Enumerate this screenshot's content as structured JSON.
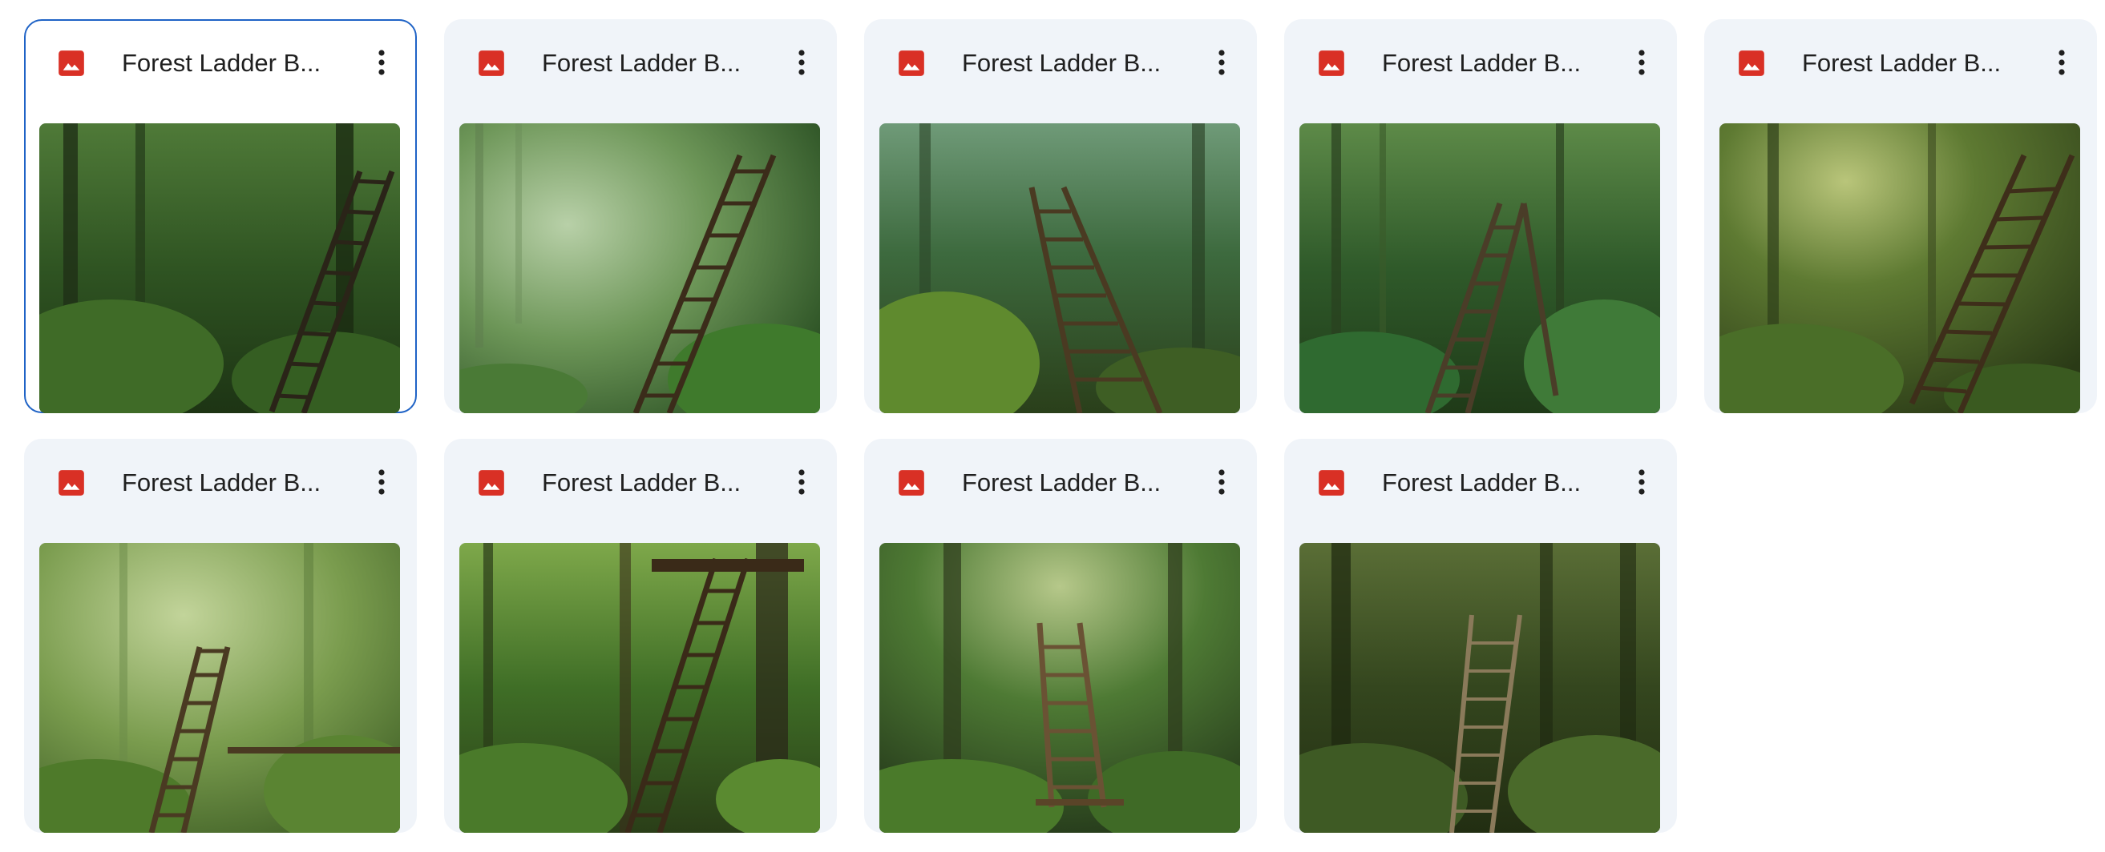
{
  "files": [
    {
      "name": "Forest Ladder B...",
      "selected": true
    },
    {
      "name": "Forest Ladder B...",
      "selected": false
    },
    {
      "name": "Forest Ladder B...",
      "selected": false
    },
    {
      "name": "Forest Ladder B...",
      "selected": false
    },
    {
      "name": "Forest Ladder B...",
      "selected": false
    },
    {
      "name": "Forest Ladder B...",
      "selected": false
    },
    {
      "name": "Forest Ladder B...",
      "selected": false
    },
    {
      "name": "Forest Ladder B...",
      "selected": false
    },
    {
      "name": "Forest Ladder B...",
      "selected": false
    }
  ],
  "icons": {
    "file_type": "image-file-icon",
    "menu": "more-vert-icon"
  },
  "colors": {
    "card_bg": "#f0f4f9",
    "selected_border": "#1f63c6",
    "image_icon": "#d93025",
    "text": "#1f1f1f"
  }
}
